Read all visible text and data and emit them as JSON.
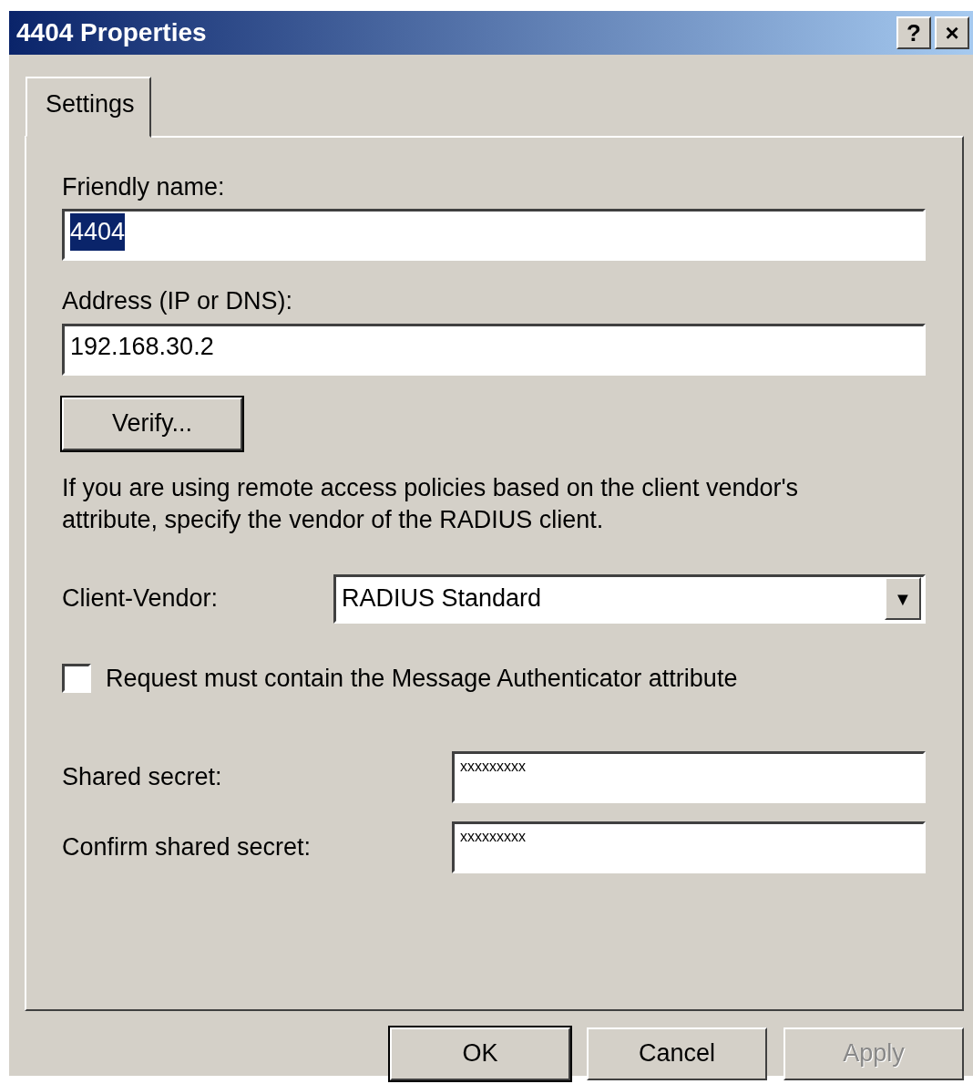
{
  "window": {
    "title": "4404 Properties",
    "help_button": "?",
    "close_button": "×"
  },
  "tabs": [
    {
      "label": "Settings",
      "selected": true
    }
  ],
  "fields": [
    {
      "label": "Friendly name:",
      "value": "4404",
      "text_selected": true
    },
    {
      "label": "Address (IP or DNS):",
      "value": "192.168.30.2",
      "text_selected": false
    }
  ],
  "verify_button": {
    "label": "Verify..."
  },
  "description": "If you are using remote access policies based on the client vendor's attribute, specify the vendor of the RADIUS client.",
  "client_vendor": {
    "label": "Client-Vendor:",
    "value": "RADIUS Standard",
    "dropdown_arrow": "▼"
  },
  "message_authenticator": {
    "label": "Request must contain the Message Authenticator attribute",
    "checked": false
  },
  "secrets": [
    {
      "label": "Shared secret:",
      "value": "xxxxxxxxx"
    },
    {
      "label": "Confirm shared secret:",
      "value": "xxxxxxxxx"
    }
  ],
  "buttons": [
    {
      "label": "OK",
      "default": true,
      "disabled": false
    },
    {
      "label": "Cancel",
      "default": false,
      "disabled": false
    },
    {
      "label": "Apply",
      "default": false,
      "disabled": true
    }
  ]
}
